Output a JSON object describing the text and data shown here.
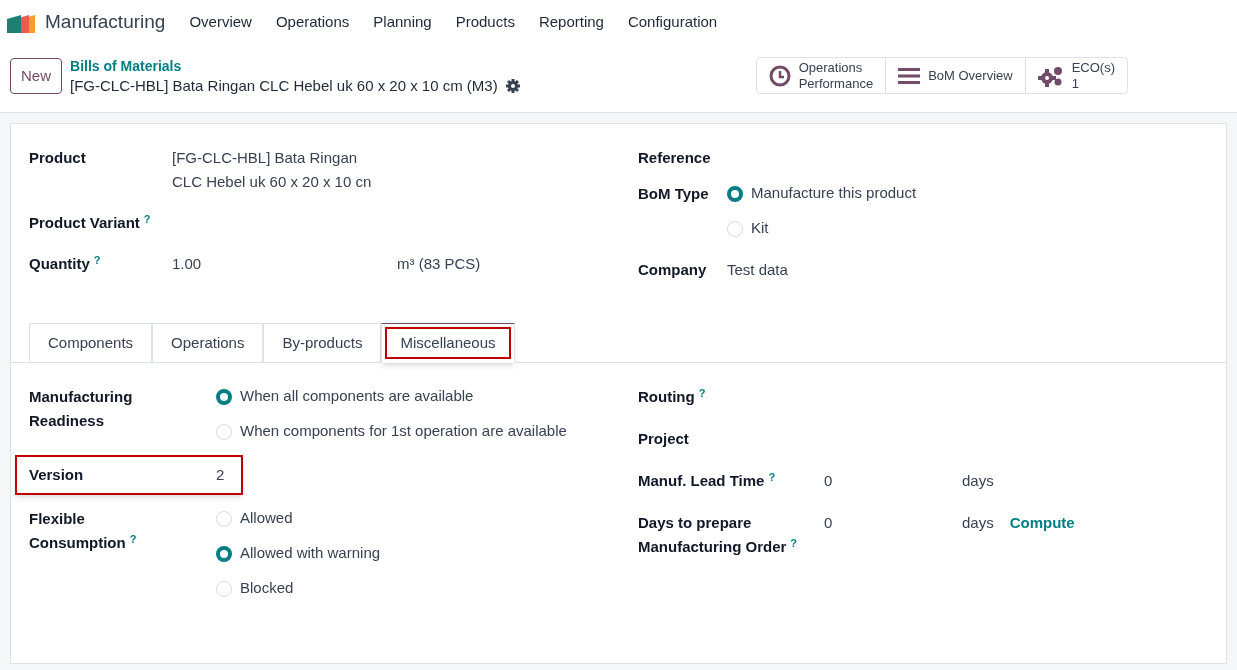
{
  "app": {
    "name": "Manufacturing"
  },
  "menu": [
    "Overview",
    "Operations",
    "Planning",
    "Products",
    "Reporting",
    "Configuration"
  ],
  "new_button": "New",
  "breadcrumb": {
    "parent": "Bills of Materials",
    "title": "[FG-CLC-HBL] Bata Ringan CLC Hebel uk 60 x 20 x 10 cm (M3)"
  },
  "stat_buttons": [
    {
      "kind": "clock",
      "lines": [
        "Operations",
        "Performance"
      ]
    },
    {
      "kind": "list",
      "lines": [
        "BoM Overview"
      ]
    },
    {
      "kind": "gears",
      "lines": [
        "ECO(s)",
        "1"
      ]
    }
  ],
  "header_left": [
    {
      "kind": "text",
      "label": "Product",
      "value": "[FG-CLC-HBL] Bata Ringan CLC Hebel uk 60 x 20 x 10 cn"
    },
    {
      "kind": "text",
      "label": "Product Variant",
      "help": "?"
    },
    {
      "kind": "text",
      "label": "Quantity",
      "help": "?",
      "value": "1.00",
      "unit": "m³ (83 PCS)"
    }
  ],
  "header_right": [
    {
      "kind": "text",
      "label": "Reference"
    },
    {
      "kind": "radio",
      "label": "BoM Type",
      "options": [
        {
          "label": "Manufacture this product",
          "selected": true
        },
        {
          "label": "Kit",
          "selected": false
        }
      ]
    },
    {
      "kind": "text",
      "label": "Company",
      "value": "Test data"
    }
  ],
  "tabs": [
    {
      "label": "Components",
      "selected": false,
      "highlighted": false
    },
    {
      "label": "Operations",
      "selected": false,
      "highlighted": false
    },
    {
      "label": "By-products",
      "selected": false,
      "highlighted": false
    },
    {
      "label": "Miscellaneous",
      "selected": true,
      "highlighted": true
    }
  ],
  "misc_left": [
    {
      "kind": "radio",
      "label": "Manufacturing Readiness",
      "options": [
        {
          "label": "When all components are available",
          "selected": true
        },
        {
          "label": "When components for 1st operation are available",
          "selected": false
        }
      ]
    },
    {
      "kind": "text",
      "label": "Version",
      "highlighted": true,
      "value": "2"
    },
    {
      "kind": "radio",
      "label": "Flexible Consumption",
      "help": "?",
      "options": [
        {
          "label": "Allowed",
          "selected": false
        },
        {
          "label": "Allowed with warning",
          "selected": true
        },
        {
          "label": "Blocked",
          "selected": false
        }
      ]
    }
  ],
  "misc_right": [
    {
      "kind": "text",
      "label": "Routing",
      "help": "?"
    },
    {
      "kind": "text",
      "label": "Project"
    },
    {
      "kind": "text",
      "label": "Manuf. Lead Time",
      "help": "?",
      "value": "0",
      "unit": "days"
    },
    {
      "kind": "text",
      "label": "Days to prepare Manufacturing Order",
      "help": "?",
      "value": "0",
      "unit": "days",
      "action": "Compute"
    }
  ]
}
